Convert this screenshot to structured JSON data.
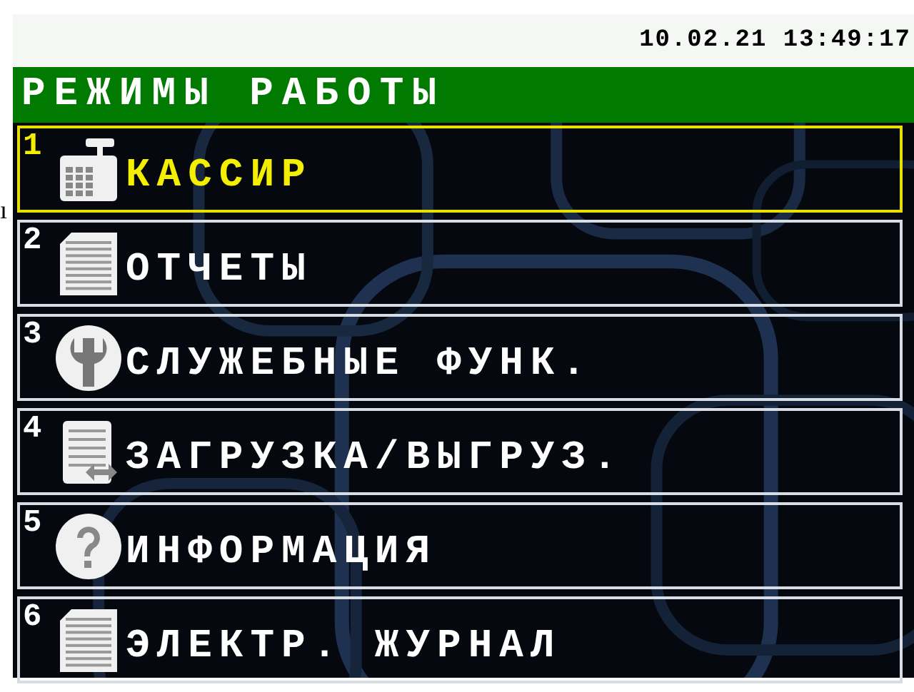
{
  "edge_fragment": "ı",
  "status_bar": {
    "datetime": "10.02.21 13:49:17"
  },
  "header": {
    "title": "РЕЖИМЫ РАБОТЫ"
  },
  "menu": {
    "items": [
      {
        "number": "1",
        "label": "КАССИР",
        "kind": "register",
        "selected": true
      },
      {
        "number": "2",
        "label": "ОТЧЕТЫ",
        "kind": "report",
        "selected": false
      },
      {
        "number": "3",
        "label": "СЛУЖЕБНЫЕ ФУНК.",
        "kind": "wrench",
        "selected": false
      },
      {
        "number": "4",
        "label": "ЗАГРУЗКА/ВЫГРУЗ.",
        "kind": "transfer",
        "selected": false
      },
      {
        "number": "5",
        "label": "ИНФОРМАЦИЯ",
        "kind": "help",
        "selected": false
      },
      {
        "number": "6",
        "label": "ЭЛЕКТР. ЖУРНАЛ",
        "kind": "report",
        "selected": false
      }
    ]
  }
}
